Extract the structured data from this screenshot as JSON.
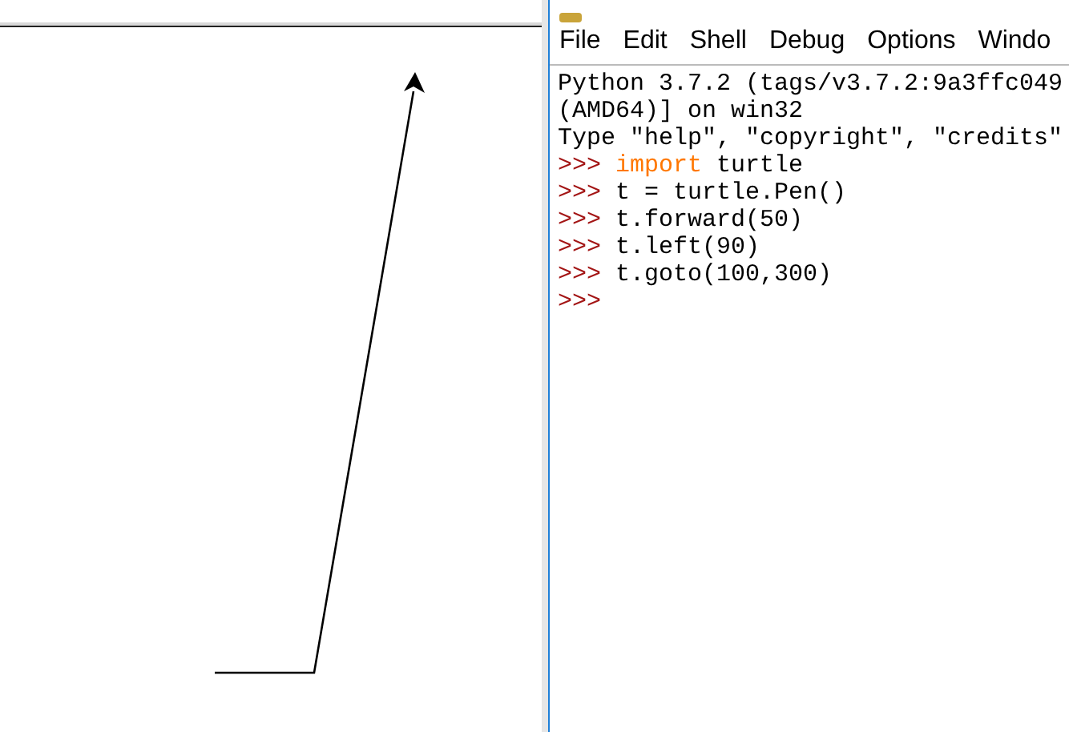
{
  "shell_window": {
    "menu": [
      {
        "label": "File"
      },
      {
        "label": "Edit"
      },
      {
        "label": "Shell"
      },
      {
        "label": "Debug"
      },
      {
        "label": "Options"
      },
      {
        "label": "Windo"
      }
    ],
    "lines": [
      {
        "kind": "output",
        "text": "Python 3.7.2 (tags/v3.7.2:9a3ffc049"
      },
      {
        "kind": "output",
        "text": "(AMD64)] on win32"
      },
      {
        "kind": "output",
        "text": "Type \"help\", \"copyright\", \"credits\""
      },
      {
        "kind": "input",
        "prompt": ">>>",
        "keyword": "import",
        "code": " turtle"
      },
      {
        "kind": "input",
        "prompt": ">>>",
        "code": "t = turtle.Pen()"
      },
      {
        "kind": "input",
        "prompt": ">>>",
        "code": "t.forward(50)"
      },
      {
        "kind": "input",
        "prompt": ">>>",
        "code": "t.left(90)"
      },
      {
        "kind": "input",
        "prompt": ">>>",
        "code": "t.goto(100,300)"
      },
      {
        "kind": "input",
        "prompt": ">>>"
      }
    ]
  }
}
